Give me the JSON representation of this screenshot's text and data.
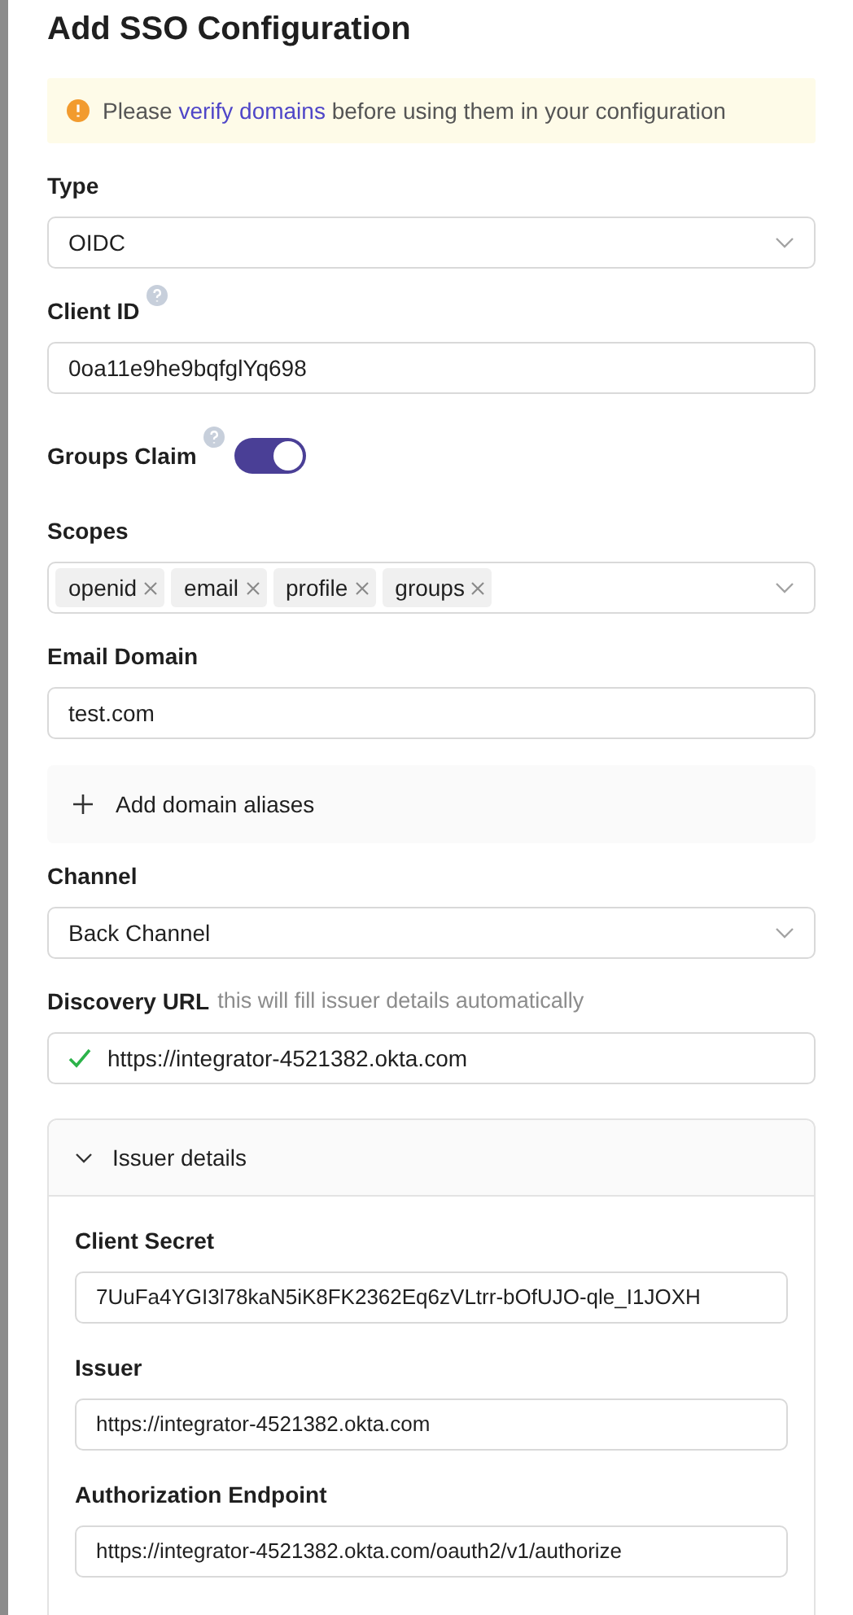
{
  "title": "Add SSO Configuration",
  "alert": {
    "before": "Please",
    "link": "verify domains",
    "after": "before using them in your configuration"
  },
  "type": {
    "label": "Type",
    "value": "OIDC"
  },
  "client_id": {
    "label": "Client ID",
    "value": "0oa11e9he9bqfglYq698"
  },
  "groups_claim": {
    "label": "Groups Claim",
    "on": true
  },
  "scopes": {
    "label": "Scopes",
    "tags": [
      "openid",
      "email",
      "profile",
      "groups"
    ]
  },
  "email_domain": {
    "label": "Email Domain",
    "value": "test.com"
  },
  "add_aliases": "Add domain aliases",
  "channel": {
    "label": "Channel",
    "value": "Back Channel"
  },
  "discovery_url": {
    "label": "Discovery URL",
    "hint": "this will fill issuer details automatically",
    "value": "https://integrator-4521382.okta.com",
    "verified": true
  },
  "issuer_details": {
    "title": "Issuer details",
    "expanded": true,
    "fields": [
      {
        "label": "Client Secret",
        "value": "7UuFa4YGI3l78kaN5iK8FK2362Eq6zVLtrr-bOfUJO-qle_I1JOXH"
      },
      {
        "label": "Issuer",
        "value": "https://integrator-4521382.okta.com"
      },
      {
        "label": "Authorization Endpoint",
        "value": "https://integrator-4521382.okta.com/oauth2/v1/authorize"
      }
    ]
  }
}
